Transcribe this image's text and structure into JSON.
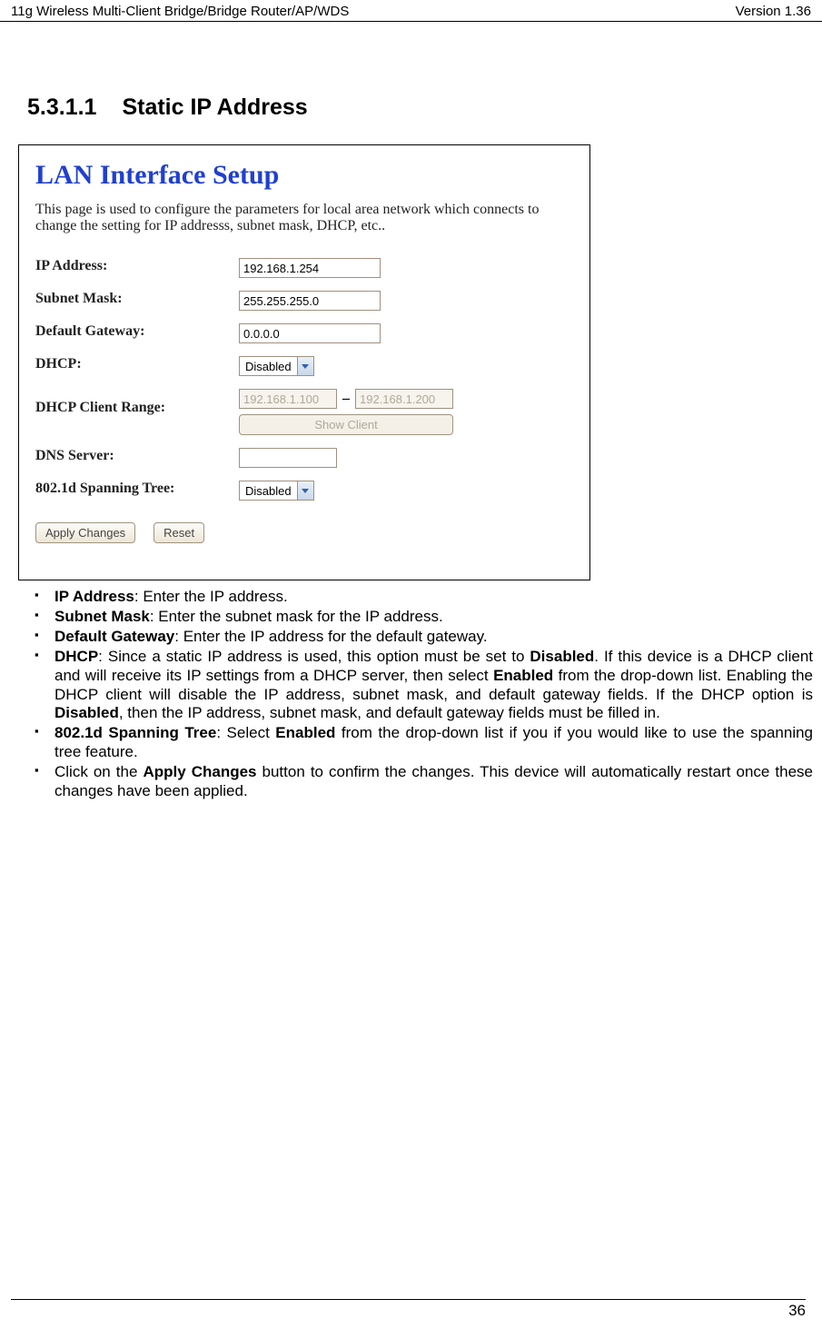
{
  "header": {
    "left": "11g Wireless Multi-Client Bridge/Bridge Router/AP/WDS",
    "right": "Version 1.36"
  },
  "section": {
    "number": "5.3.1.1",
    "title": "Static IP Address"
  },
  "figure": {
    "title": "LAN Interface Setup",
    "desc": "This page is used to configure the parameters for local area network which connects to change the setting for IP addresss, subnet mask, DHCP, etc..",
    "ip_label": "IP Address:",
    "ip_value": "192.168.1.254",
    "mask_label": "Subnet Mask:",
    "mask_value": "255.255.255.0",
    "gw_label": "Default Gateway:",
    "gw_value": "0.0.0.0",
    "dhcp_label": "DHCP:",
    "dhcp_value": "Disabled",
    "range_label": "DHCP Client Range:",
    "range_start": "192.168.1.100",
    "range_end": "192.168.1.200",
    "show_client": "Show Client",
    "dns_label": "DNS Server:",
    "dns_value": "",
    "spanning_label": "802.1d Spanning Tree:",
    "spanning_value": "Disabled",
    "apply_btn": "Apply Changes",
    "reset_btn": "Reset"
  },
  "notes": {
    "ip_bold": "IP Address",
    "ip_rest": ": Enter the IP address.",
    "mask_bold": "Subnet Mask",
    "mask_rest": ": Enter the subnet mask for the IP address.",
    "gw_bold": "Default Gateway",
    "gw_rest": ": Enter the IP address for the default gateway.",
    "dhcp_bold": "DHCP",
    "dhcp_rest1": ": Since a static IP address is used, this option must be set to ",
    "dhcp_rest1b": "Disabled",
    "dhcp_rest2": ".  If this device is a DHCP client and will receive its IP settings from a DHCP server, then select ",
    "dhcp_rest2b": "Enabled",
    "dhcp_rest3": " from the drop-down list. Enabling the DHCP client will disable the IP address, subnet mask, and default gateway fields. If the DHCP option is ",
    "dhcp_rest3b": "Disabled",
    "dhcp_rest4": ", then the IP address, subnet mask, and default gateway fields must be filled in.",
    "sp_bold": "802.1d Spanning Tree",
    "sp_rest1": ": Select ",
    "sp_rest1b": "Enabled",
    "sp_rest2": " from the drop-down list if you if you would like to use the spanning tree feature.",
    "apply_rest1": "Click on the ",
    "apply_bold": "Apply Changes",
    "apply_rest2": " button to confirm the changes. This device will automatically restart once these changes have been applied."
  },
  "footer": {
    "page": "36"
  }
}
